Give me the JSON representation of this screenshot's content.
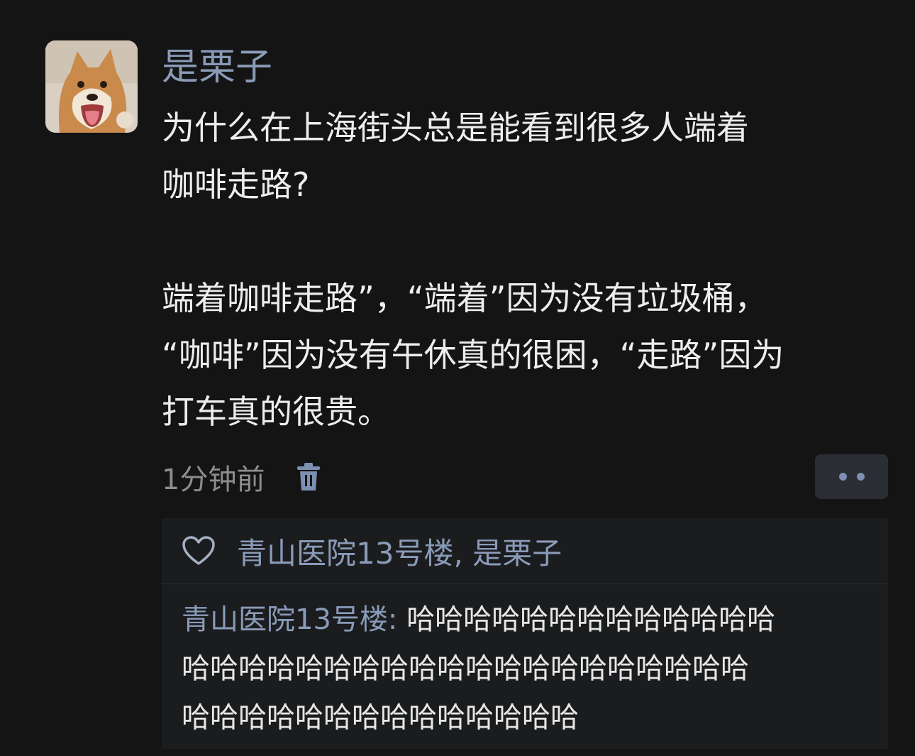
{
  "post": {
    "username": "是栗子",
    "question_line1": "为什么在上海街头总是能看到很多人端着",
    "question_line2": "咖啡走路?",
    "answer_line1": "端着咖啡走路”，“端着”因为没有垃圾桶，",
    "answer_line2": "“咖啡”因为没有午休真的很困，“走路”因为",
    "answer_line3": "打车真的很贵。",
    "timestamp": "1分钟前"
  },
  "icons": {
    "avatar": "shiba-dog-avatar",
    "delete": "trash-icon",
    "like": "heart-icon",
    "more": "more-dots-icon"
  },
  "likes": {
    "names": "青山医院13号楼, 是栗子"
  },
  "comment": {
    "author": "青山医院13号楼",
    "separator": ": ",
    "text_line1": "哈哈哈哈哈哈哈哈哈哈哈哈哈",
    "text_line2": "哈哈哈哈哈哈哈哈哈哈哈哈哈哈哈哈哈哈哈哈",
    "text_line3": "哈哈哈哈哈哈哈哈哈哈哈哈哈哈"
  },
  "colors": {
    "background": "#141415",
    "accent_name": "#8a9bb8",
    "comment_panel": "#1b1c1e"
  }
}
